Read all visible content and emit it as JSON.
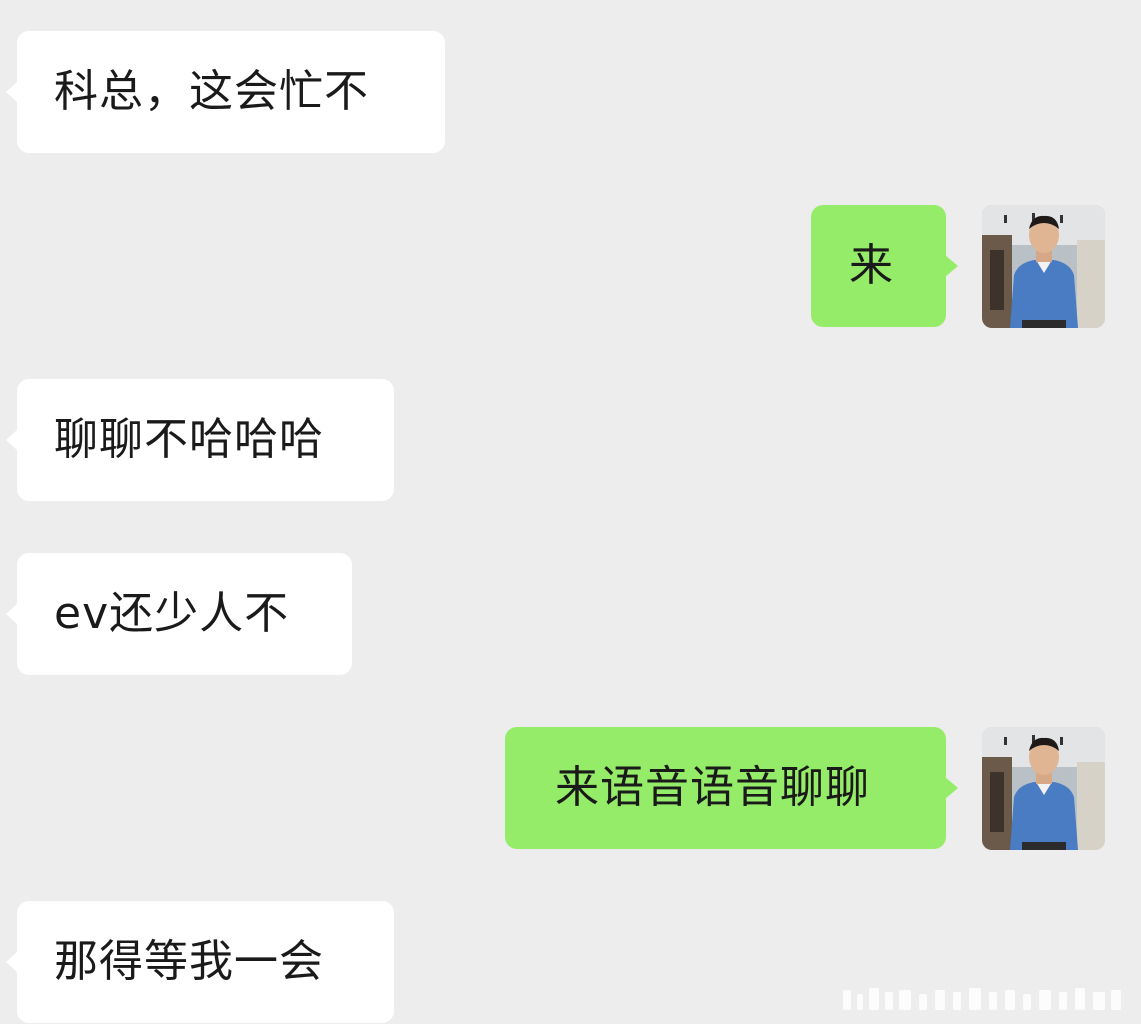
{
  "messages": [
    {
      "direction": "incoming",
      "text": "科总，这会忙不"
    },
    {
      "direction": "outgoing",
      "text": "来"
    },
    {
      "direction": "incoming",
      "text": "聊聊不哈哈哈"
    },
    {
      "direction": "incoming",
      "text": "ev还少人不"
    },
    {
      "direction": "outgoing",
      "text": "来语音语音聊聊"
    },
    {
      "direction": "incoming",
      "text": "那得等我一会"
    }
  ],
  "avatar": {
    "icon": "user-avatar-photo",
    "shirt_color": "#4a7cc4"
  },
  "theme": {
    "background": "#ededed",
    "incoming_bubble": "#ffffff",
    "outgoing_bubble": "#95ec69",
    "text": "#1a1a1a"
  }
}
